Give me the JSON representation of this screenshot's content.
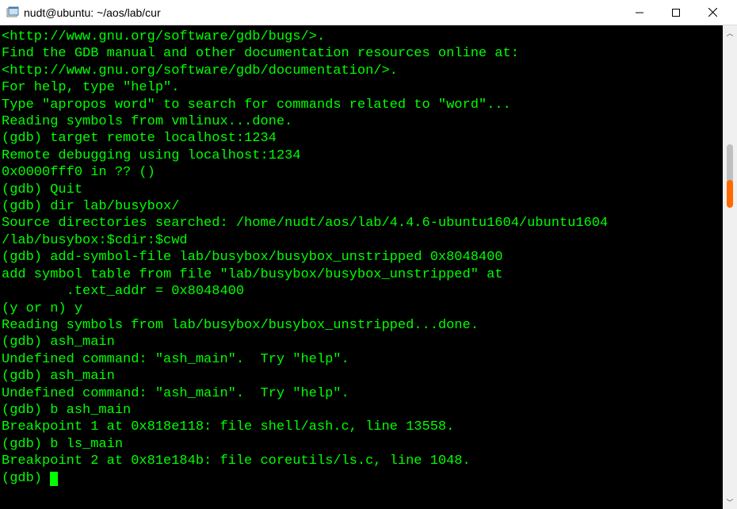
{
  "window": {
    "title": "nudt@ubuntu: ~/aos/lab/cur"
  },
  "terminal": {
    "lines": [
      "<http://www.gnu.org/software/gdb/bugs/>.",
      "Find the GDB manual and other documentation resources online at:",
      "<http://www.gnu.org/software/gdb/documentation/>.",
      "For help, type \"help\".",
      "Type \"apropos word\" to search for commands related to \"word\"...",
      "Reading symbols from vmlinux...done.",
      "(gdb) target remote localhost:1234",
      "Remote debugging using localhost:1234",
      "0x0000fff0 in ?? ()",
      "(gdb) Quit",
      "(gdb) dir lab/busybox/",
      "Source directories searched: /home/nudt/aos/lab/4.4.6-ubuntu1604/ubuntu1604",
      "/lab/busybox:$cdir:$cwd",
      "(gdb) add-symbol-file lab/busybox/busybox_unstripped 0x8048400",
      "add symbol table from file \"lab/busybox/busybox_unstripped\" at",
      "        .text_addr = 0x8048400",
      "(y or n) y",
      "Reading symbols from lab/busybox/busybox_unstripped...done.",
      "(gdb) ash_main",
      "Undefined command: \"ash_main\".  Try \"help\".",
      "(gdb) ash_main",
      "Undefined command: \"ash_main\".  Try \"help\".",
      "(gdb) b ash_main",
      "Breakpoint 1 at 0x818e118: file shell/ash.c, line 13558.",
      "(gdb) b ls_main",
      "Breakpoint 2 at 0x81e184b: file coreutils/ls.c, line 1048."
    ],
    "prompt": "(gdb) "
  }
}
